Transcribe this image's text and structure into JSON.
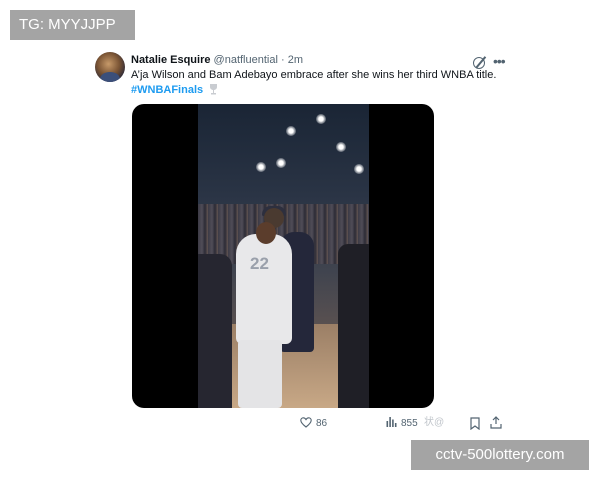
{
  "watermarks": {
    "top_left": "TG: MYYJJPP",
    "bottom_right": "cctv-500lottery.com",
    "overlay_fragment": "状@"
  },
  "tweet": {
    "author_name": "Natalie Esquire",
    "author_handle": "@natfluential",
    "separator": "·",
    "time": "2m",
    "text": "A’ja Wilson and Bam Adebayo embrace after she wins her third WNBA title.",
    "hashtag": "#WNBAFinals",
    "video": {
      "jersey_number": "22"
    },
    "stats": {
      "likes": "86",
      "views": "855"
    },
    "icons": {
      "avatar": "avatar",
      "grok": "grok-icon",
      "more": "more-icon",
      "trophy": "trophy-icon",
      "like": "heart-icon",
      "views": "views-icon",
      "bookmark": "bookmark-icon",
      "share": "share-icon"
    },
    "colors": {
      "hashtag": "#1d9bf0",
      "secondary_text": "#536471",
      "media_background": "#000000"
    }
  }
}
